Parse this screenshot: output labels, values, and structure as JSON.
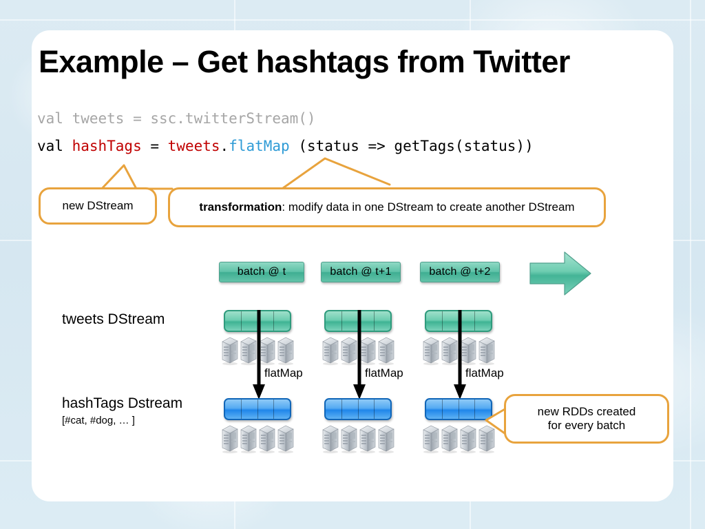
{
  "slide": {
    "title": "Example – Get hashtags from Twitter",
    "background_color": "#dbe9f1",
    "card_color": "#ffffff",
    "accent_color": "#e8a33d"
  },
  "code": {
    "line1": {
      "full": "val tweets = ssc.twitterStream()",
      "color": "#a6a6a6",
      "t1": "val tweets = ssc.twitterStream()"
    },
    "line2": {
      "full": "val hashTags = tweets.flatMap (status => getTags(status))",
      "t1": "val ",
      "t2": "hashTags",
      "t3": " = ",
      "t4": "tweets",
      "t5": ".",
      "t6": "flatMap",
      "t7": " (status => getTags(status))",
      "color_keyword": "#000000",
      "color_identifier": "#c00000",
      "color_method": "#2e9bd6"
    }
  },
  "callouts": [
    {
      "id": "new-dstream",
      "text": "new DStream"
    },
    {
      "id": "transformation",
      "bold": "transformation",
      "rest": ": modify data in one DStream to create another DStream"
    },
    {
      "id": "new-rdds",
      "line1": "new RDDs created",
      "line2": "for every batch"
    }
  ],
  "timeline": {
    "batches": [
      {
        "label": "batch @ t"
      },
      {
        "label": "batch @ t+1"
      },
      {
        "label": "batch @ t+2"
      }
    ],
    "arrow_name": "time-direction-arrow",
    "arrow_color": "#5fc2a8"
  },
  "rows": [
    {
      "id": "tweets",
      "label": "tweets DStream",
      "sublabel": "",
      "rdd_color": "#3fb494",
      "cells": 4
    },
    {
      "id": "hashtags",
      "label": "hashTags Dstream",
      "sublabel": "[#cat, #dog, … ]",
      "rdd_color": "#1f86ea",
      "cells": 4
    }
  ],
  "transform": {
    "label": "flatMap",
    "count": 3
  },
  "servers": {
    "per_group": 4,
    "groups": 6,
    "color": "#b5bcc4"
  }
}
